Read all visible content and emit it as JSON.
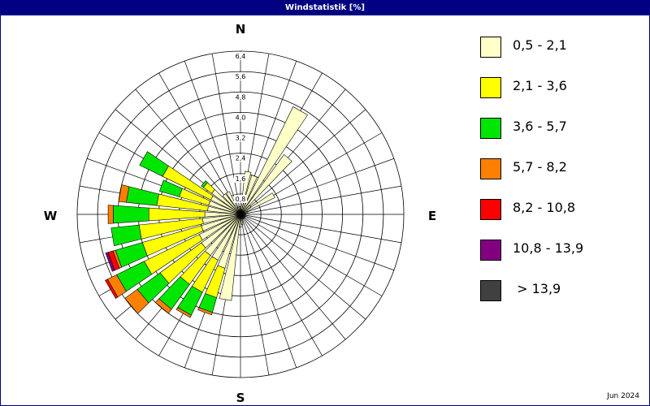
{
  "window": {
    "title": "Windstatistik [%]"
  },
  "footer": {
    "date": "Jun 2024"
  },
  "chart_data": {
    "type": "polar-bar",
    "title": "Windstatistik [%]",
    "directions": {
      "N": "N",
      "E": "E",
      "S": "S",
      "W": "W"
    },
    "ring_labels": [
      "0,8",
      "1,6",
      "2,4",
      "3,2",
      "4,0",
      "4,8",
      "5,6",
      "6,4"
    ],
    "rmax": 6.4,
    "grid": true,
    "sector_count": 36,
    "sector_width_deg": 10,
    "legend_placement": "right",
    "classes": [
      {
        "label": "0,5 - 2,1",
        "color": "#FFFFC8"
      },
      {
        "label": "2,1 - 3,6",
        "color": "#FFFF00"
      },
      {
        "label": "3,6 - 5,7",
        "color": "#00E600"
      },
      {
        "label": "5,7 - 8,2",
        "color": "#FF8000"
      },
      {
        "label": "8,2 - 10,8",
        "color": "#FF0000"
      },
      {
        "label": "10,8 - 13,9",
        "color": "#800080"
      },
      {
        "label": " > 13,9",
        "color": "#404040"
      }
    ],
    "sectors": [
      {
        "dir": 10,
        "values": [
          1.7,
          0,
          0,
          0,
          0,
          0,
          0
        ]
      },
      {
        "dir": 20,
        "values": [
          1.6,
          0,
          0,
          0,
          0,
          0,
          0
        ]
      },
      {
        "dir": 30,
        "values": [
          4.7,
          0,
          0,
          0,
          0,
          0,
          0
        ]
      },
      {
        "dir": 40,
        "values": [
          2.9,
          0,
          0,
          0,
          0,
          0,
          0
        ]
      },
      {
        "dir": 50,
        "values": [
          0.5,
          0,
          0,
          0,
          0,
          0,
          0
        ]
      },
      {
        "dir": 60,
        "values": [
          1.5,
          0,
          0,
          0,
          0,
          0,
          0
        ]
      },
      {
        "dir": 70,
        "values": [
          0.3,
          0,
          0,
          0,
          0,
          0,
          0
        ]
      },
      {
        "dir": 80,
        "values": [
          0.2,
          0,
          0,
          0,
          0,
          0,
          0
        ]
      },
      {
        "dir": 90,
        "values": [
          0.2,
          0,
          0,
          0,
          0,
          0,
          0
        ]
      },
      {
        "dir": 100,
        "values": [
          0.2,
          0,
          0,
          0,
          0,
          0,
          0
        ]
      },
      {
        "dir": 110,
        "values": [
          0.2,
          0,
          0,
          0,
          0,
          0,
          0
        ]
      },
      {
        "dir": 120,
        "values": [
          0.2,
          0,
          0,
          0,
          0,
          0,
          0
        ]
      },
      {
        "dir": 130,
        "values": [
          0.2,
          0,
          0,
          0,
          0,
          0,
          0
        ]
      },
      {
        "dir": 140,
        "values": [
          0.2,
          0,
          0,
          0,
          0,
          0,
          0
        ]
      },
      {
        "dir": 150,
        "values": [
          0.2,
          0,
          0,
          0,
          0,
          0,
          0
        ]
      },
      {
        "dir": 160,
        "values": [
          0.2,
          0,
          0,
          0,
          0,
          0,
          0
        ]
      },
      {
        "dir": 170,
        "values": [
          0.4,
          0,
          0,
          0,
          0,
          0,
          0
        ]
      },
      {
        "dir": 180,
        "values": [
          0.5,
          0,
          0,
          0,
          0,
          0,
          0
        ]
      },
      {
        "dir": 190,
        "values": [
          3.4,
          0,
          0,
          0,
          0,
          0,
          0
        ]
      },
      {
        "dir": 200,
        "values": [
          2.2,
          1.2,
          0.6,
          0.1,
          0,
          0,
          0
        ]
      },
      {
        "dir": 210,
        "values": [
          2.0,
          1.4,
          1.0,
          0.1,
          0,
          0,
          0
        ]
      },
      {
        "dir": 220,
        "values": [
          2.0,
          1.4,
          1.2,
          0.2,
          0,
          0,
          0
        ]
      },
      {
        "dir": 230,
        "values": [
          1.9,
          2.0,
          1.1,
          0.6,
          0,
          0,
          0
        ]
      },
      {
        "dir": 240,
        "values": [
          1.8,
          2.4,
          1.2,
          0.4,
          0.1,
          0,
          0
        ]
      },
      {
        "dir": 250,
        "values": [
          1.6,
          2.4,
          1.1,
          0.1,
          0.2,
          0.1,
          0
        ]
      },
      {
        "dir": 260,
        "values": [
          1.5,
          2.5,
          1.1,
          0,
          0,
          0,
          0
        ]
      },
      {
        "dir": 270,
        "values": [
          1.4,
          2.2,
          1.4,
          0.2,
          0,
          0,
          0
        ]
      },
      {
        "dir": 280,
        "values": [
          1.3,
          2.0,
          1.2,
          0.3,
          0,
          0,
          0
        ]
      },
      {
        "dir": 290,
        "values": [
          1.3,
          1.2,
          0.8,
          0,
          0,
          0,
          0
        ]
      },
      {
        "dir": 300,
        "values": [
          1.3,
          2.1,
          1.0,
          0,
          0,
          0,
          0
        ]
      },
      {
        "dir": 310,
        "values": [
          1.4,
          0.4,
          0.1,
          0,
          0,
          0,
          0
        ]
      },
      {
        "dir": 320,
        "values": [
          1.0,
          0,
          0,
          0,
          0,
          0,
          0
        ]
      },
      {
        "dir": 330,
        "values": [
          1.0,
          0,
          0,
          0,
          0,
          0,
          0
        ]
      },
      {
        "dir": 340,
        "values": [
          0.3,
          0,
          0,
          0,
          0,
          0,
          0
        ]
      },
      {
        "dir": 350,
        "values": [
          0.3,
          0,
          0,
          0,
          0,
          0,
          0
        ]
      },
      {
        "dir": 360,
        "values": [
          0.3,
          0,
          0,
          0,
          0,
          0,
          0
        ]
      }
    ]
  }
}
